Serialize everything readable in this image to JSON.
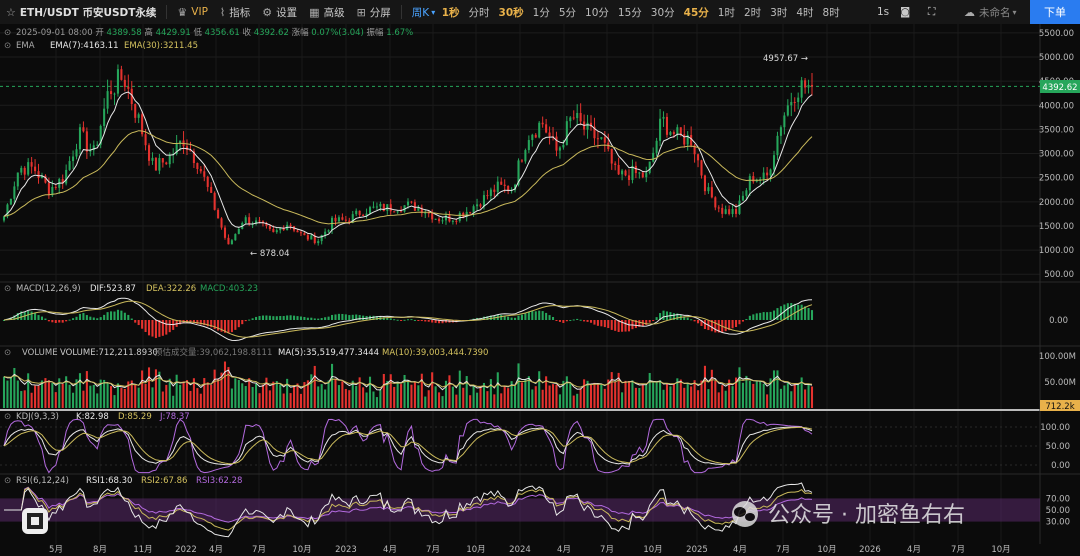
{
  "toolbar": {
    "symbol": "ETH/USDT 币安USDT永续",
    "vip": "VIP",
    "indicators": "指标",
    "settings": "设置",
    "advanced": "高级",
    "split": "分屏",
    "period_select": "周K",
    "timeframes": [
      "1秒",
      "分时",
      "30秒",
      "1分",
      "5分",
      "10分",
      "15分",
      "30分",
      "45分",
      "1时",
      "2时",
      "3时",
      "4时",
      "8时"
    ],
    "highlighted": [
      "1秒",
      "30秒",
      "45分"
    ],
    "interval": "1s",
    "layout_name": "未命名",
    "order_button": "下单"
  },
  "info": {
    "ohlc_line": [
      [
        "2025-09-01 08:00",
        ""
      ],
      [
        "开",
        "4389.58"
      ],
      [
        "高",
        "4429.91"
      ],
      [
        "低",
        "4356.61"
      ],
      [
        "收",
        "4392.62"
      ],
      [
        "涨幅",
        "0.07%(3.04)"
      ],
      [
        "振幅",
        "1.67%"
      ]
    ],
    "ema_name": "EMA",
    "ema7": "EMA(7):4163.11",
    "ema30": "EMA(30):3211.45"
  },
  "macd_legend": {
    "name": "MACD(12,26,9)",
    "dif": "DIF:523.87",
    "dea": "DEA:322.26",
    "macd": "MACD:403.23"
  },
  "volume_legend": {
    "name": "VOLUME",
    "volume": "VOLUME:712,211.8930",
    "estimate": "预估成交量:39,062,198.8111",
    "ma5": "MA(5):35,519,477.3444",
    "ma10": "MA(10):39,003,444.7390"
  },
  "kdj_legend": {
    "name": "KDJ(9,3,3)",
    "k": "K:82.98",
    "d": "D:85.29",
    "j": "J:78.37"
  },
  "rsi_legend": {
    "name": "RSI(6,12,24)",
    "r1": "RSI1:68.30",
    "r2": "RSI2:67.86",
    "r3": "RSI3:62.28"
  },
  "colors": {
    "up": "#26a65b",
    "down": "#e5322e",
    "ema7": "#e8e8e8",
    "ema30": "#c9b95b",
    "last": "#26a65b",
    "bg": "#0b0b0b"
  },
  "watermark": "公众号 · 加密鱼右右",
  "chart_data": {
    "type": "candlestick",
    "title": "ETH/USDT 币安USDT永续",
    "interval": "周K",
    "x_ticks": [
      "5月",
      "8月",
      "11月",
      "2022",
      "4月",
      "7月",
      "10月",
      "2023",
      "4月",
      "7月",
      "10月",
      "2024",
      "4月",
      "7月",
      "10月",
      "2025",
      "4月",
      "7月",
      "10月",
      "2026",
      "4月",
      "7月",
      "10月"
    ],
    "price_axis": {
      "ticks": [
        "5500.00",
        "5000.00",
        "4500.00",
        "4000.00",
        "3500.00",
        "3000.00",
        "2500.00",
        "2000.00",
        "1500.00",
        "1000.00",
        "500.00"
      ],
      "range": [
        380,
        5560
      ]
    },
    "last_price": "4392.62",
    "high_label": "4957.67",
    "low_label": "878.04",
    "close_series": [
      {
        "d": "2021-03",
        "v": 1700
      },
      {
        "d": "2021-04",
        "v": 2700
      },
      {
        "d": "2021-05",
        "v": 2700
      },
      {
        "d": "2021-06",
        "v": 2250
      },
      {
        "d": "2021-07",
        "v": 2500
      },
      {
        "d": "2021-08",
        "v": 3400
      },
      {
        "d": "2021-09",
        "v": 3000
      },
      {
        "d": "2021-10",
        "v": 4300
      },
      {
        "d": "2021-11",
        "v": 4600
      },
      {
        "d": "2021-12",
        "v": 3700
      },
      {
        "d": "2022-01",
        "v": 2700
      },
      {
        "d": "2022-02",
        "v": 2900
      },
      {
        "d": "2022-03",
        "v": 3300
      },
      {
        "d": "2022-04",
        "v": 2800
      },
      {
        "d": "2022-05",
        "v": 1950
      },
      {
        "d": "2022-06",
        "v": 1070
      },
      {
        "d": "2022-07",
        "v": 1650
      },
      {
        "d": "2022-08",
        "v": 1550
      },
      {
        "d": "2022-09",
        "v": 1330
      },
      {
        "d": "2022-10",
        "v": 1570
      },
      {
        "d": "2022-11",
        "v": 1280
      },
      {
        "d": "2022-12",
        "v": 1200
      },
      {
        "d": "2023-01",
        "v": 1600
      },
      {
        "d": "2023-02",
        "v": 1620
      },
      {
        "d": "2023-03",
        "v": 1820
      },
      {
        "d": "2023-04",
        "v": 1870
      },
      {
        "d": "2023-05",
        "v": 1880
      },
      {
        "d": "2023-06",
        "v": 1930
      },
      {
        "d": "2023-07",
        "v": 1860
      },
      {
        "d": "2023-08",
        "v": 1650
      },
      {
        "d": "2023-09",
        "v": 1670
      },
      {
        "d": "2023-10",
        "v": 1820
      },
      {
        "d": "2023-11",
        "v": 2050
      },
      {
        "d": "2023-12",
        "v": 2300
      },
      {
        "d": "2024-01",
        "v": 2280
      },
      {
        "d": "2024-02",
        "v": 3380
      },
      {
        "d": "2024-03",
        "v": 3650
      },
      {
        "d": "2024-04",
        "v": 3020
      },
      {
        "d": "2024-05",
        "v": 3770
      },
      {
        "d": "2024-06",
        "v": 3450
      },
      {
        "d": "2024-07",
        "v": 3250
      },
      {
        "d": "2024-08",
        "v": 2520
      },
      {
        "d": "2024-09",
        "v": 2600
      },
      {
        "d": "2024-10",
        "v": 2520
      },
      {
        "d": "2024-11",
        "v": 3700
      },
      {
        "d": "2024-12",
        "v": 3350
      },
      {
        "d": "2025-01",
        "v": 3300
      },
      {
        "d": "2025-02",
        "v": 2230
      },
      {
        "d": "2025-03",
        "v": 1820
      },
      {
        "d": "2025-04",
        "v": 1790
      },
      {
        "d": "2025-05",
        "v": 2520
      },
      {
        "d": "2025-06",
        "v": 2480
      },
      {
        "d": "2025-07",
        "v": 3700
      },
      {
        "d": "2025-08",
        "v": 4390
      },
      {
        "d": "2025-09",
        "v": 4392.62
      }
    ],
    "macd": {
      "dif": 523.87,
      "dea": 322.26,
      "macd": 403.23,
      "axis_ticks": [
        "0.00"
      ]
    },
    "volume": {
      "axis_ticks": [
        "100.00M",
        "50.00M"
      ],
      "last_label": "712.2k"
    },
    "kdj": {
      "axis_ticks": [
        "100.00",
        "50.00",
        "0.00"
      ]
    },
    "rsi": {
      "axis_ticks": [
        "70.00",
        "50.00",
        "30.00"
      ]
    }
  }
}
